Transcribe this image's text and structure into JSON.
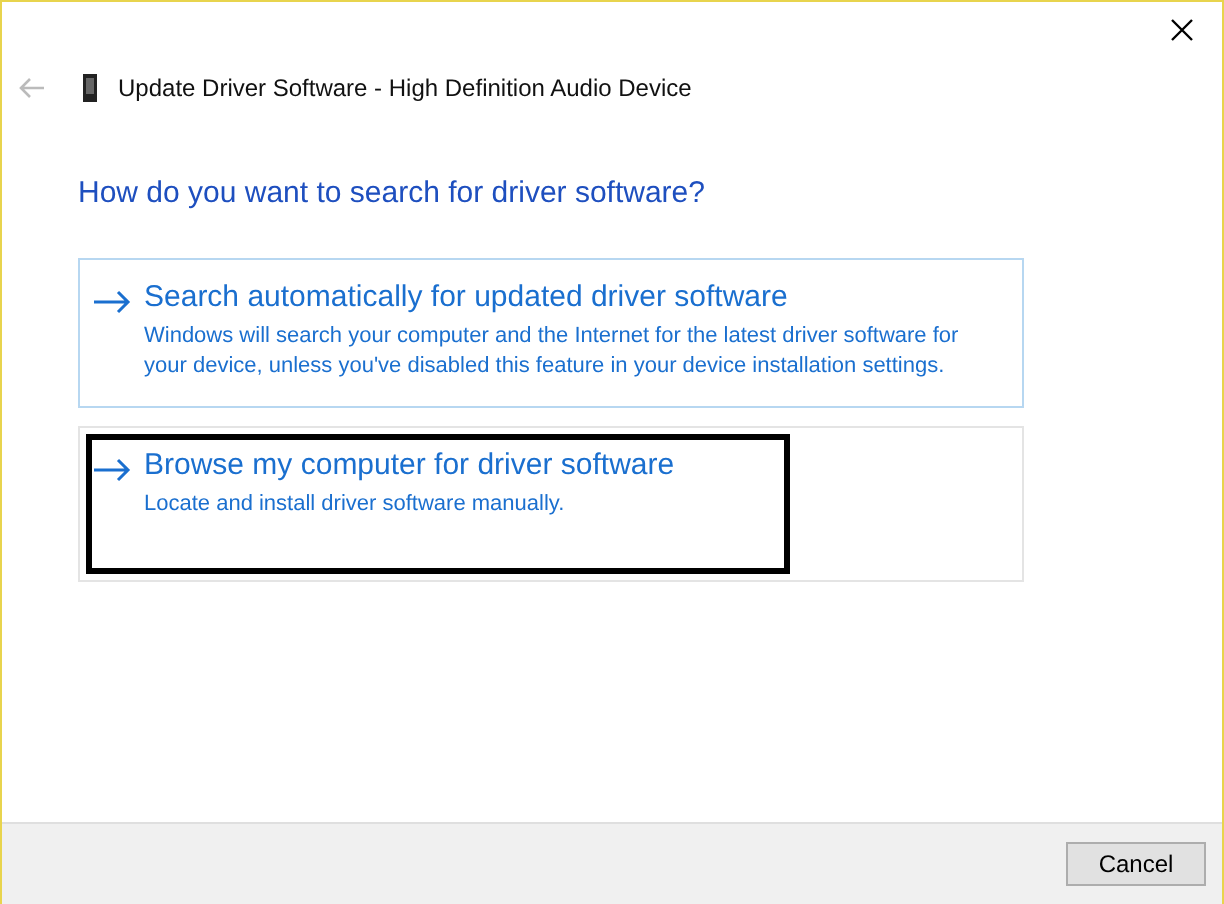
{
  "window": {
    "title": "Update Driver Software - High Definition Audio Device"
  },
  "heading": "How do you want to search for driver software?",
  "options": [
    {
      "title": "Search automatically for updated driver software",
      "description": "Windows will search your computer and the Internet for the latest driver software for your device, unless you've disabled this feature in your device installation settings.",
      "highlighted": true,
      "marked": false
    },
    {
      "title": "Browse my computer for driver software",
      "description": "Locate and install driver software manually.",
      "highlighted": false,
      "marked": true
    }
  ],
  "buttons": [
    "Cancel"
  ]
}
